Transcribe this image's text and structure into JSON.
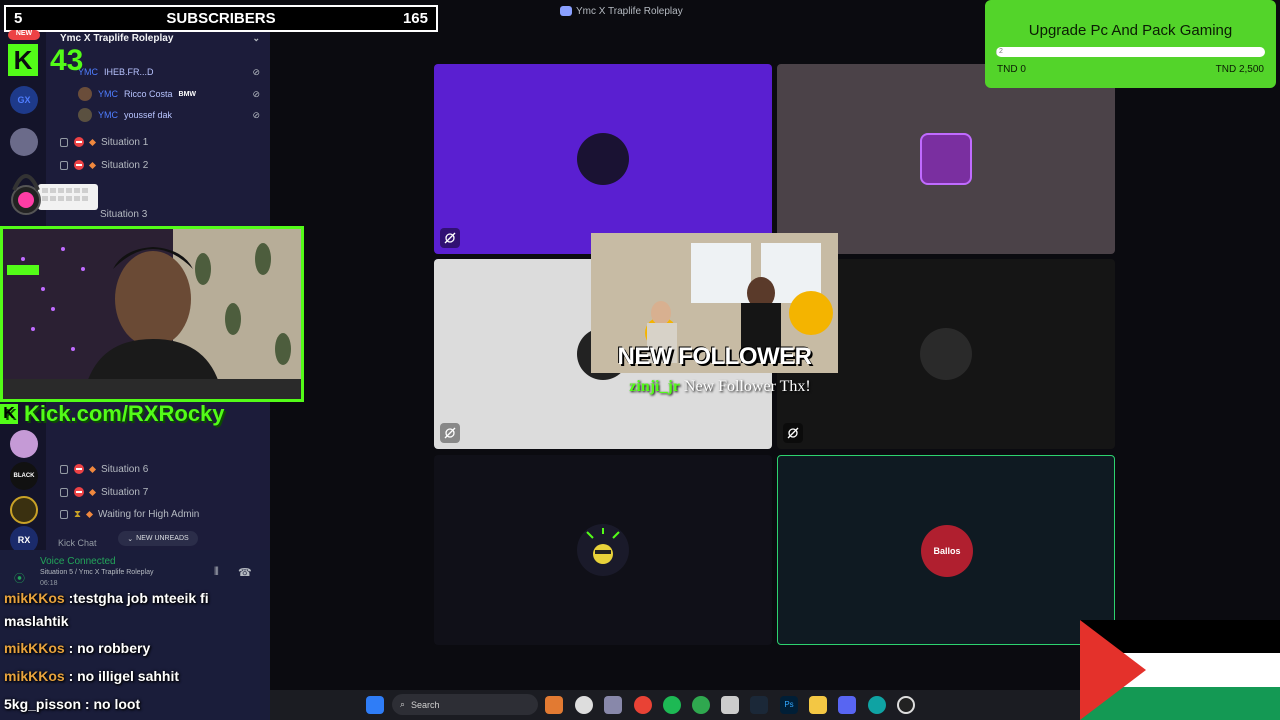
{
  "window": {
    "title": "Ymc X Traplife Roleplay"
  },
  "subscribers": {
    "count_left": "5",
    "label": "SUBSCRIBERS",
    "count_right": "165"
  },
  "kick": {
    "badge_letter": "K",
    "viewer_count": "43",
    "new_badge": "NEW",
    "url": "Kick.com/RXRocky"
  },
  "server": {
    "name": "Ymc X Traplife Roleplay"
  },
  "members_top": [
    {
      "tag": "YMC",
      "name": "IHEB.FR...D"
    },
    {
      "tag": "YMC",
      "name": "Ricco Costa",
      "extra": "BMW"
    },
    {
      "tag": "YMC",
      "name": "youssef dak"
    }
  ],
  "channels": [
    {
      "name": "Situation 1"
    },
    {
      "name": "Situation 2"
    },
    {
      "name": "Situation 3"
    },
    {
      "name": "Situation 6"
    },
    {
      "name": "Situation 7"
    },
    {
      "name": "Waiting for High Admin"
    }
  ],
  "sidebar_misc": {
    "new_unreads": "NEW UNREADS",
    "kick_chat": "Kick Chat",
    "voice_connected": "Voice Connected",
    "voice_channel": "Situation 5 / Ymc X Traplife Roleplay",
    "voice_time": "06:18"
  },
  "server_rail": [
    {
      "label": "GX",
      "color": "#1e3a8a"
    },
    {
      "label": "",
      "color": "#6b6b8a"
    },
    {
      "label": "",
      "color": "#c59ad6"
    },
    {
      "label": "BLACK",
      "color": "#111111"
    },
    {
      "label": "",
      "color": "#3a3010"
    },
    {
      "label": "RX",
      "color": "#1b2b6b"
    }
  ],
  "chat_messages": [
    {
      "user": "mikKKos",
      "text": ":testgha job mteeik fi"
    },
    {
      "user": "",
      "text": "maslahtik"
    },
    {
      "user": "mikKKos",
      "text": ": no robbery"
    },
    {
      "user": "mikKKos",
      "text": ": no illigel sahhit"
    },
    {
      "user": "5kg_pisson",
      "text": ": no loot"
    }
  ],
  "alert": {
    "title": "NEW FOLLOWER",
    "follower": "zinji_jr",
    "message": " New Follower Thx!"
  },
  "goal": {
    "title": "Upgrade Pc And Pack Gaming",
    "progress_label": "2",
    "progress_fraction": 0.001,
    "min_label": "TND 0",
    "max_label": "TND 2,500"
  },
  "tiles": [
    {
      "bg": "#5a1fd1",
      "avatar": "#1a1233"
    },
    {
      "bg": "#4b4248",
      "avatar": "#7a2fa0"
    },
    {
      "bg": "#dcdcdc",
      "avatar": "#222222"
    },
    {
      "bg": "#151515",
      "avatar": "#2a2a2a"
    },
    {
      "bg": "#101018",
      "avatar": "#1a1a2a"
    },
    {
      "bg": "#0f1a22",
      "avatar": "#b01f2f",
      "label": "Ballos"
    }
  ],
  "taskbar": {
    "search_placeholder": "Search"
  }
}
